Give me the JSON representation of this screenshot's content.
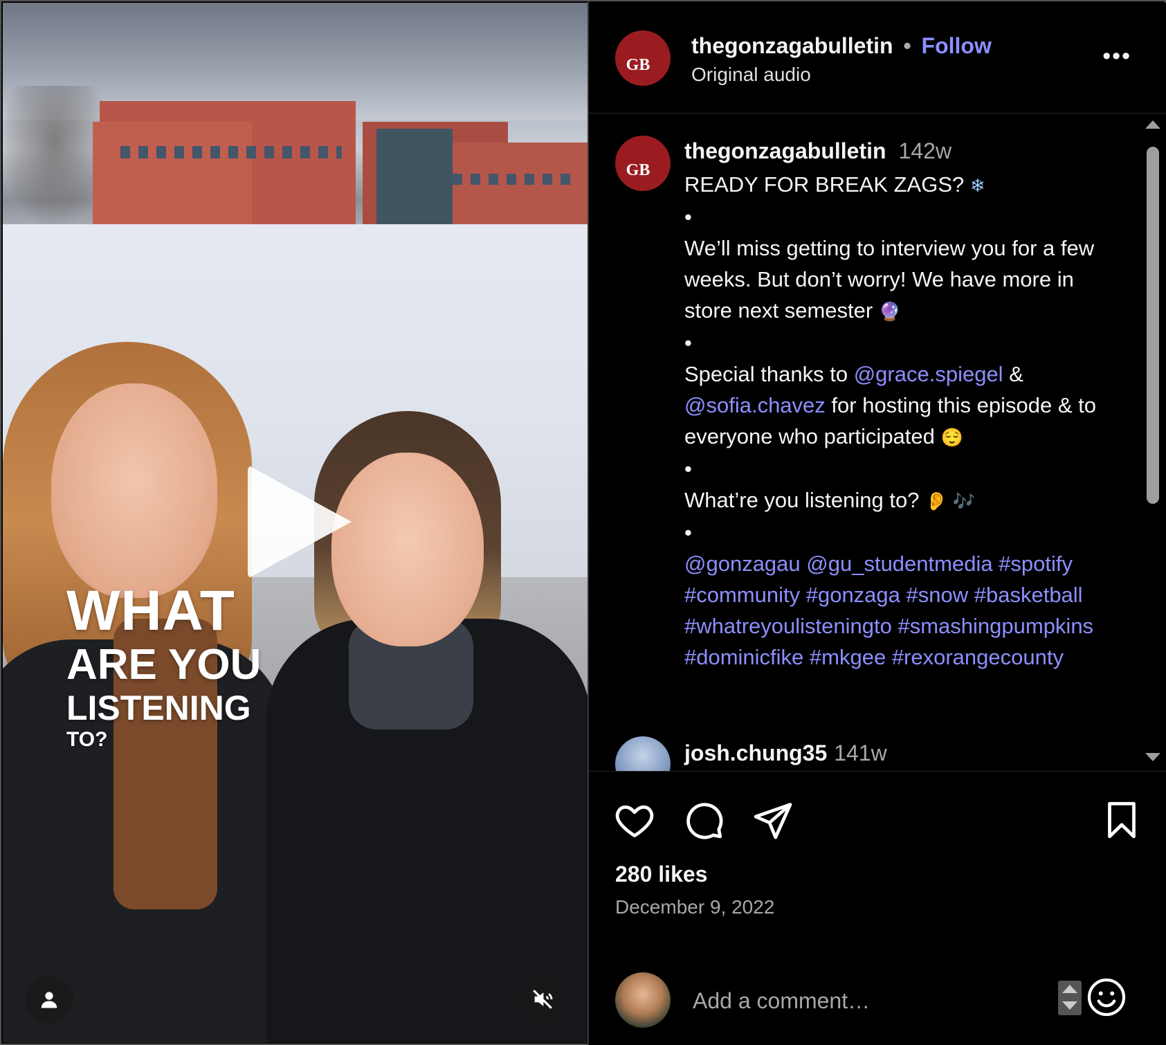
{
  "video": {
    "overlay_lines": [
      "WHAT",
      "ARE YOU",
      "LISTENING",
      "TO?"
    ],
    "play_icon": "play-icon",
    "user_icon": "user-icon",
    "mute_icon": "muted-speaker-icon"
  },
  "header": {
    "username": "thegonzagabulletin",
    "separator": "•",
    "follow_label": "Follow",
    "subtitle": "Original audio",
    "more_icon": "more-options-icon",
    "avatar_text": "GB"
  },
  "caption": {
    "username": "thegonzagabulletin",
    "time": "142w",
    "line1": "READY FOR BREAK ZAGS? ",
    "emoji_snowflake": "❄",
    "bullet1": "•",
    "para1": "We’ll miss getting to interview you for a few weeks. But don’t worry! We have more in store next semester ",
    "emoji_crystal": "🔮",
    "bullet2": "•",
    "thanks_pre": "Special thanks to ",
    "mention_grace": "@grace.spiegel",
    "thanks_amp": " & ",
    "mention_sofia": "@sofia.chavez",
    "thanks_post": " for hosting this episode & to everyone who participated ",
    "emoji_relieved": "😌",
    "bullet3": "•",
    "question": "What’re you listening to? ",
    "emoji_ear": "👂",
    "emoji_notes": " 🎶",
    "bullet4": "•",
    "tags": "@gonzagau @gu_studentmedia #spotify #community #gonzaga #snow #basketball #whatreyoulisteningto #smashingpumpkins #dominicfike #mkgee #rexorangecounty"
  },
  "comment": {
    "username": "josh.chung35",
    "time": "141w"
  },
  "actions": {
    "likes": "280 likes",
    "date": "December 9, 2022"
  },
  "add_comment": {
    "placeholder": "Add a comment…"
  },
  "colors": {
    "link": "#8d8fff",
    "muted": "#a8a8a8",
    "brand_red": "#9a1c20",
    "background": "#000000"
  }
}
